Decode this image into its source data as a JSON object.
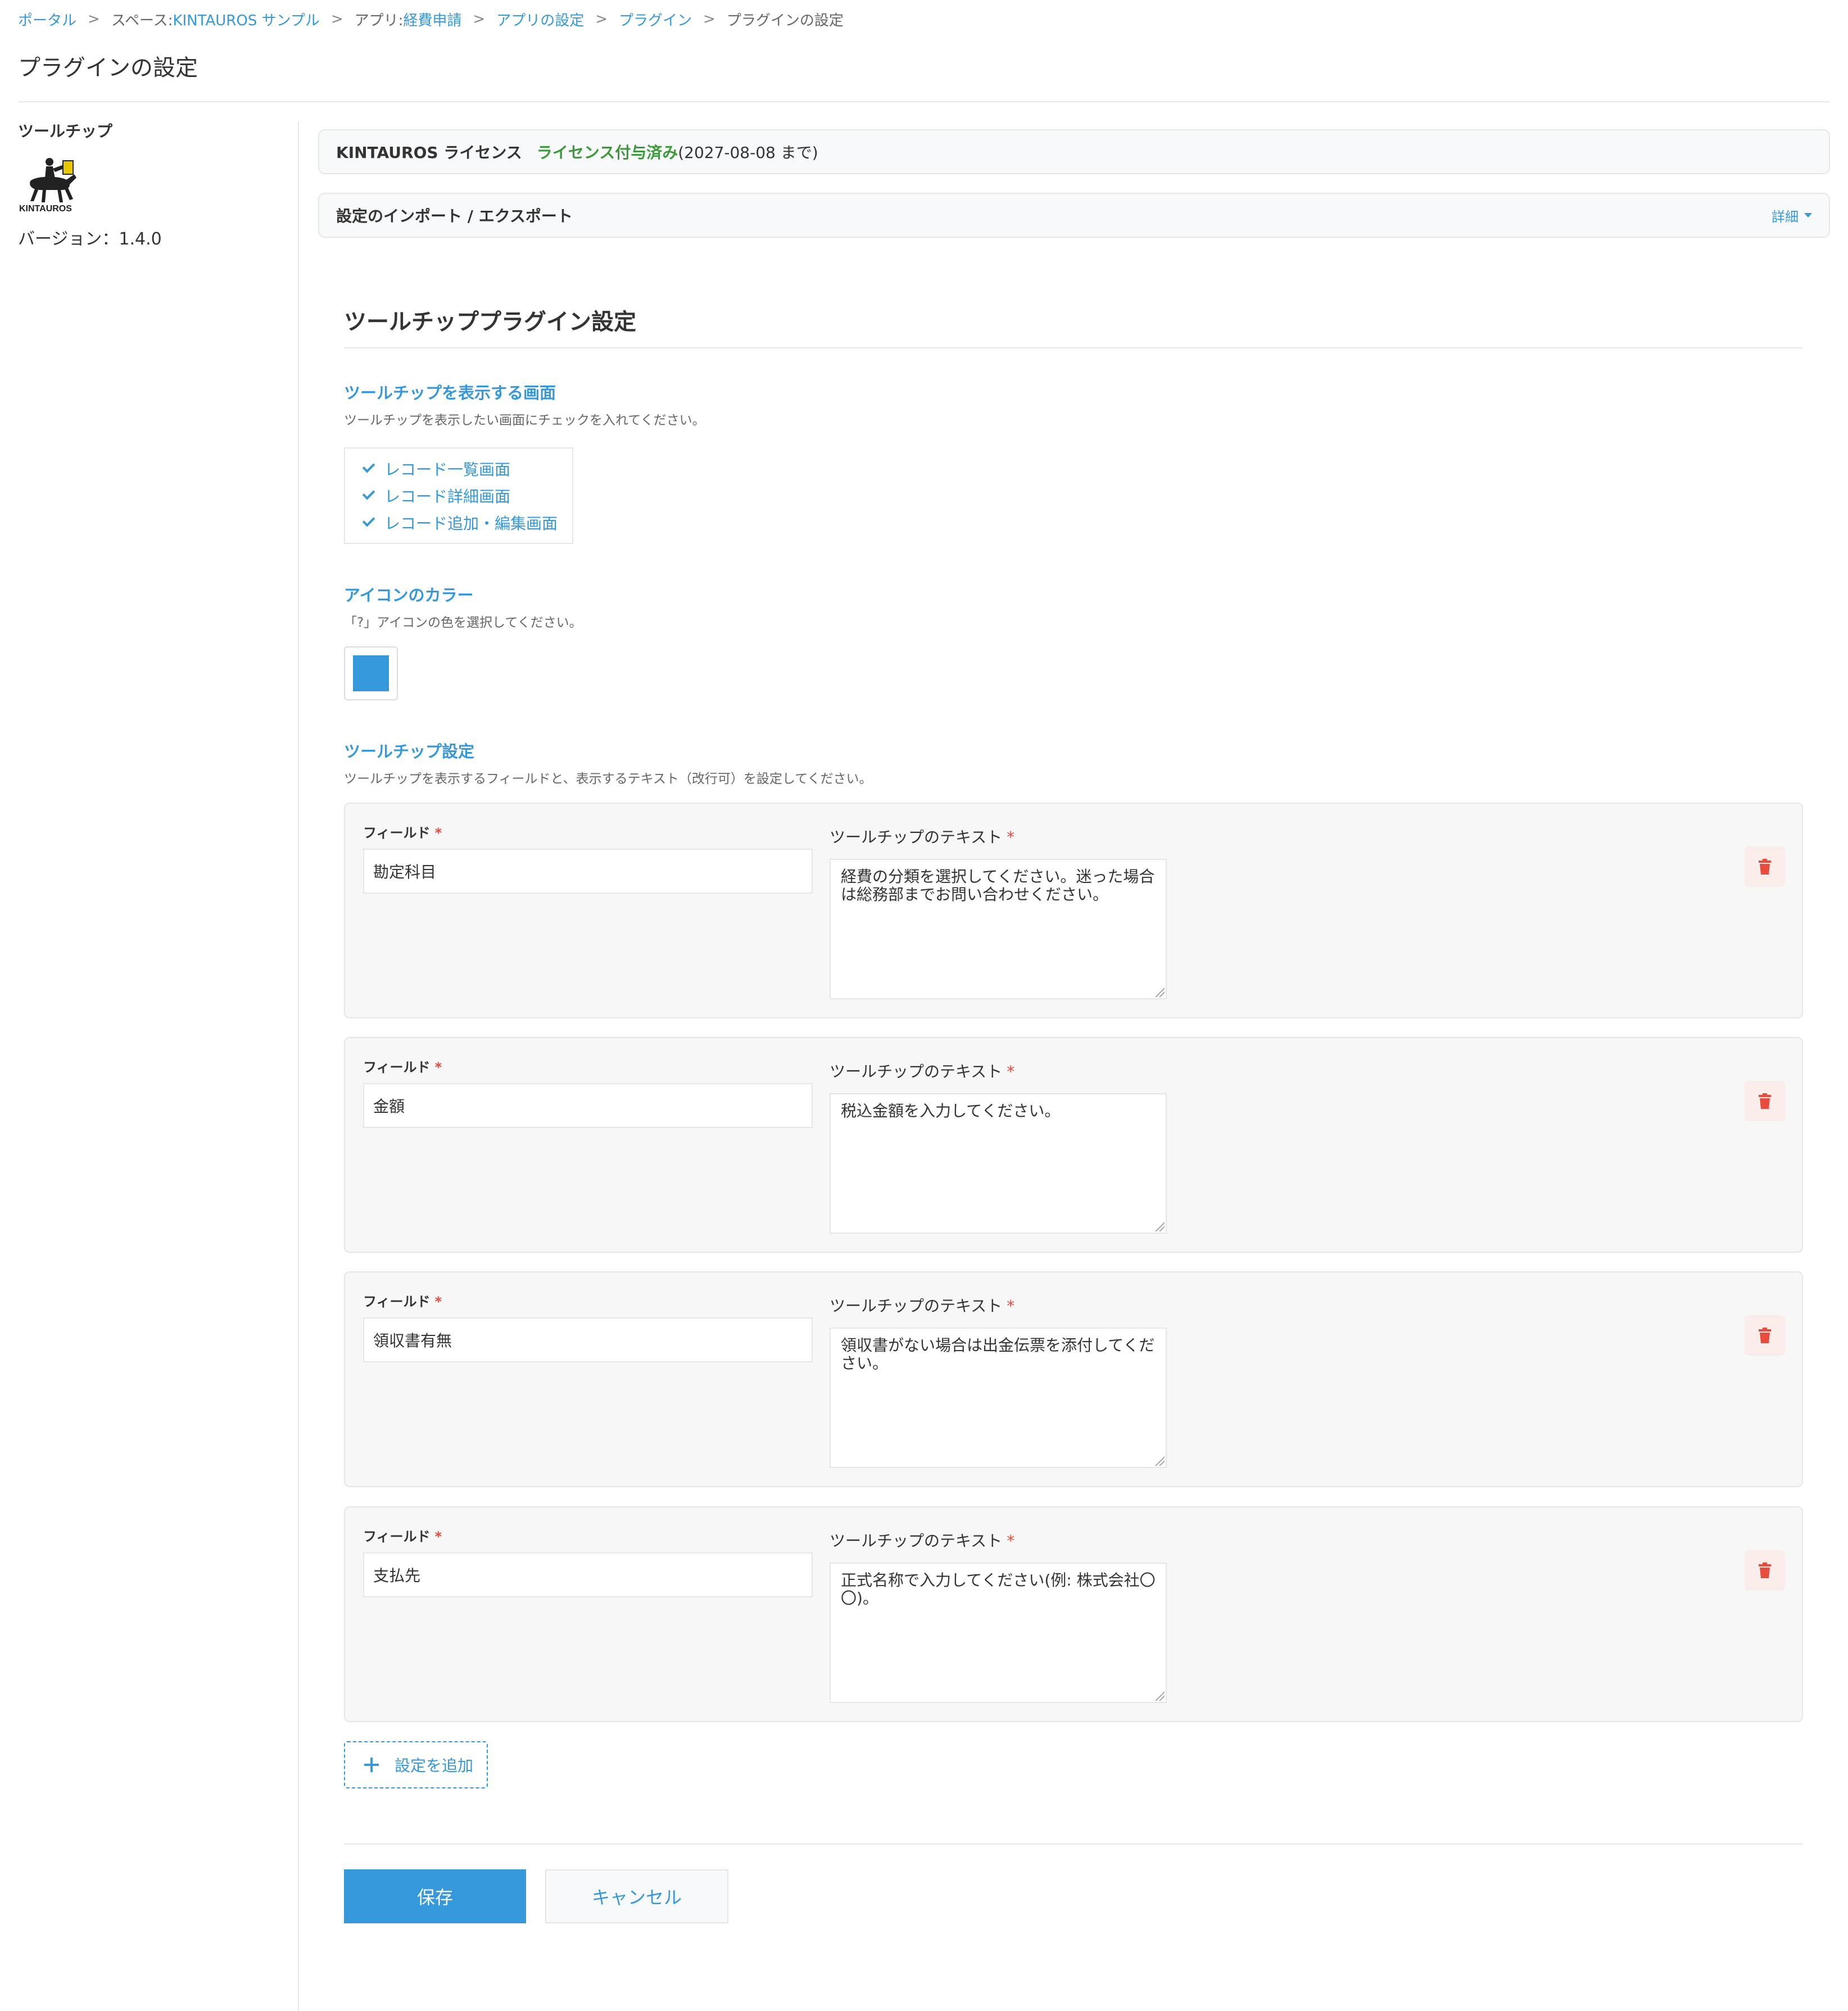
{
  "breadcrumb": {
    "portal": "ポータル",
    "space_prefix": "スペース: ",
    "space_name": "KINTAUROS サンプル",
    "app_prefix": "アプリ: ",
    "app_name": "経費申請",
    "app_settings": "アプリの設定",
    "plugins": "プラグイン",
    "current": "プラグインの設定",
    "separator": ">"
  },
  "page_title": "プラグインの設定",
  "sidebar": {
    "plugin_name": "ツールチップ",
    "logo_text": "KINTAUROS",
    "version": "バージョン：1.4.0"
  },
  "license": {
    "label": "KINTAUROS ライセンス",
    "status": "ライセンス付与済み",
    "expiry": "(2027-08-08 まで)"
  },
  "import_export": {
    "title": "設定のインポート / エクスポート",
    "detail_label": "詳細"
  },
  "settings": {
    "title": "ツールチッププラグイン設定",
    "screens": {
      "title": "ツールチップを表示する画面",
      "description": "ツールチップを表示したい画面にチェックを入れてください。",
      "options": [
        {
          "label": "レコード一覧画面",
          "checked": true
        },
        {
          "label": "レコード詳細画面",
          "checked": true
        },
        {
          "label": "レコード追加・編集画面",
          "checked": true
        }
      ]
    },
    "icon_color": {
      "title": "アイコンのカラー",
      "description": "「?」アイコンの色を選択してください。",
      "value": "#3498db"
    },
    "tooltips": {
      "title": "ツールチップ設定",
      "description": "ツールチップを表示するフィールドと、表示するテキスト（改行可）を設定してください。",
      "field_label": "フィールド",
      "text_label": "ツールチップのテキスト",
      "required_mark": "*",
      "rows": [
        {
          "field": "勘定科目",
          "text": "経費の分類を選択してください。迷った場合は総務部までお問い合わせください。"
        },
        {
          "field": "金額",
          "text": "税込金額を入力してください。"
        },
        {
          "field": "領収書有無",
          "text": "領収書がない場合は出金伝票を添付してください。"
        },
        {
          "field": "支払先",
          "text": "正式名称で入力してください(例: 株式会社〇〇)。"
        }
      ],
      "add_label": "設定を追加"
    }
  },
  "actions": {
    "save": "保存",
    "cancel": "キャンセル"
  },
  "colors": {
    "accent": "#3498db",
    "license_ok": "#3a9a3a",
    "required": "#e74c3c",
    "delete": "#e74c3c"
  },
  "icons": [
    "check-icon",
    "caret-down-icon",
    "trash-icon",
    "plus-icon",
    "kintauros-logo"
  ]
}
